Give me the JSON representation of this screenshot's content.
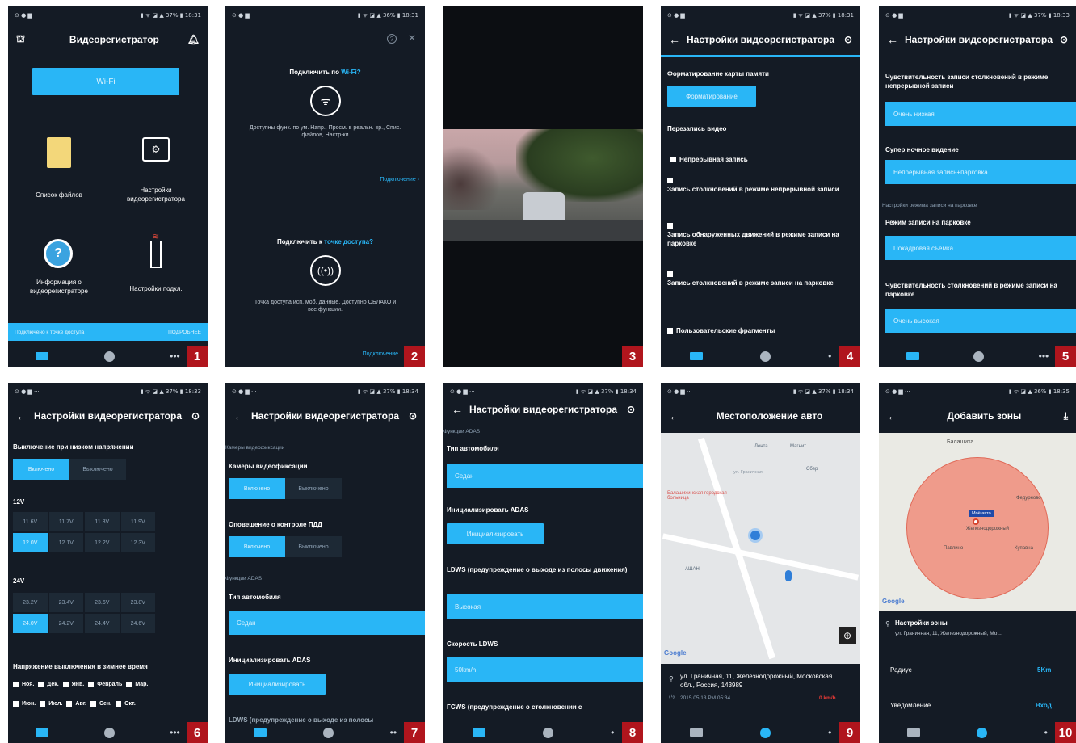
{
  "screens": {
    "s1": {
      "status_right": "▮ ᯤ ◪ ▲ 37% ▮ 18:31",
      "title": "Видеорегистратор",
      "wifi_button": "Wi-Fi",
      "tiles": [
        "Список файлов",
        "Настройки видеорегистратора",
        "Информация о видеорегистраторе",
        "Настройки подкл."
      ],
      "banner_left": "Подключено к точке доступа",
      "banner_right": "ПОДРОБНЕЕ",
      "more": "•••",
      "number": "1"
    },
    "s2": {
      "status_right": "▮ ᯤ ◪ ▲ 36% ▮ 18:31",
      "help": "?",
      "close": "✕",
      "wifi_heading_a": "Подключить по ",
      "wifi_heading_b": "Wi-Fi?",
      "wifi_desc": "Доступны функ. по ум. Напр., Просм. в реальн. вр., Спис. файлов, Настр-ки",
      "link1": "Подключение ›",
      "ap_heading_a": "Подключить к ",
      "ap_heading_b": "точке доступа?",
      "ap_desc": "Точка доступа исп. моб. данные. Доступно ОБЛАКО и все функции.",
      "link2": "Подключение",
      "number": "2"
    },
    "s3": {
      "number": "3"
    },
    "s4": {
      "status_right": "▮ ᯤ ◪ ▲ 37% ▮ 18:31",
      "title": "Настройки видеорегистратора",
      "format_label": "Форматирование карты памяти",
      "format_button": "Форматирование",
      "overwrite_label": "Перезапись видео",
      "items": [
        "Непрерывная запись",
        "Запись столкновений в режиме непрерывной записи",
        "Запись обнаруженных движений в режиме записи на парковке",
        "Запись столкновений в режиме записи на парковке",
        "Пользовательские фрагменты"
      ],
      "more": "•",
      "number": "4"
    },
    "s5": {
      "status_right": "▮ ᯤ ◪ ▲ 37% ▮ 18:33",
      "title": "Настройки видеорегистратора",
      "sens_label": "Чувствительность записи столкновений в режиме непрерывной записи",
      "sens_value": "Очень низкая",
      "night_label": "Супер ночное видение",
      "night_value": "Непрерывная запись+парковка",
      "parking_section": "Настройки режима записи на парковке",
      "parking_mode_label": "Режим записи на парковке",
      "parking_mode_value": "Покадровая съемка",
      "parking_sens_label": "Чувствительность столкновений в режиме записи на парковке",
      "parking_sens_value": "Очень высокая",
      "more": "•••",
      "number": "5"
    },
    "s6": {
      "status_right": "▮ ᯤ ◪ ▲ 37% ▮ 18:33",
      "title": "Настройки видеорегистратора",
      "lowv_label": "Выключение при низком напряжении",
      "on": "Включено",
      "off": "Выключено",
      "v12": "12V",
      "v12_opts": [
        "11.6V",
        "11.7V",
        "11.8V",
        "11.9V",
        "12.0V",
        "12.1V",
        "12.2V",
        "12.3V"
      ],
      "v24": "24V",
      "v24_opts": [
        "23.2V",
        "23.4V",
        "23.6V",
        "23.8V",
        "24.0V",
        "24.2V",
        "24.4V",
        "24.6V"
      ],
      "winter_label": "Напряжение выключения в зимнее время",
      "months1": [
        "Ноя.",
        "Дек.",
        "Янв.",
        "Февраль",
        "Мар."
      ],
      "months2": [
        "Июн.",
        "Июл.",
        "Авг.",
        "Сен.",
        "Окт."
      ],
      "more": "•••",
      "number": "6"
    },
    "s7": {
      "status_right": "▮ ᯤ ◪ ▲ 37% ▮ 18:34",
      "title": "Настройки видеорегистратора",
      "section1": "Камеры видеофиксации",
      "cams_label": "Камеры видеофиксации",
      "on": "Включено",
      "off": "Выключено",
      "traffic_label": "Оповещение о контроле ПДД",
      "section2": "Функции ADAS",
      "car_label": "Тип автомобиля",
      "car_value": "Седан",
      "adas_label": "Инициализировать ADAS",
      "adas_button": "Инициализировать",
      "ldws_cut": "LDWS (предупреждение о выходе из полосы",
      "more": "••",
      "number": "7"
    },
    "s8": {
      "status_right": "▮ ᯤ ◪ ▲ 37% ▮ 18:34",
      "title": "Настройки видеорегистратора",
      "section": "Функции ADAS",
      "car_label": "Тип автомобиля",
      "car_value": "Седан",
      "adas_label": "Инициализировать ADAS",
      "adas_button": "Инициализировать",
      "ldws_label": "LDWS (предупреждение о выходе из полосы движения)",
      "ldws_value": "Высокая",
      "speed_label": "Скорость LDWS",
      "speed_value": "50km/h",
      "fcws_label": "FCWS (предупреждение о столкновении с",
      "more": "•",
      "number": "8"
    },
    "s9": {
      "status_right": "▮ ᯤ ◪ ▲ 37% ▮ 18:34",
      "title": "Местоположение авто",
      "map_labels": [
        "Лента",
        "Магнит",
        "Сбер",
        "Балашихинская городская больница",
        "АШАН",
        "ул. Граничная"
      ],
      "google": "Google",
      "address": "ул. Граничная, 11, Железнодорожный, Московская обл., Россия, 143989",
      "time": "2015.05.13 PM 05:34",
      "speed": "0 km/h",
      "number": "9"
    },
    "s10": {
      "status_right": "▮ ᯤ ◪ ▲ 36% ▮ 18:35",
      "title": "Добавить зоны",
      "map_labels": [
        "Балашиха",
        "Железнодорожный",
        "Павлино",
        "Купавна",
        "Федурново"
      ],
      "zone_tag": "Моё авто",
      "google": "Google",
      "zone_title": "Настройки зоны",
      "zone_address": "ул. Граничная, 11, Железнодорожный, Мо...",
      "radius_label": "Радиус",
      "radius_value": "5Km",
      "notify_label": "Уведомление",
      "notify_value": "Вход",
      "number": "10"
    }
  }
}
